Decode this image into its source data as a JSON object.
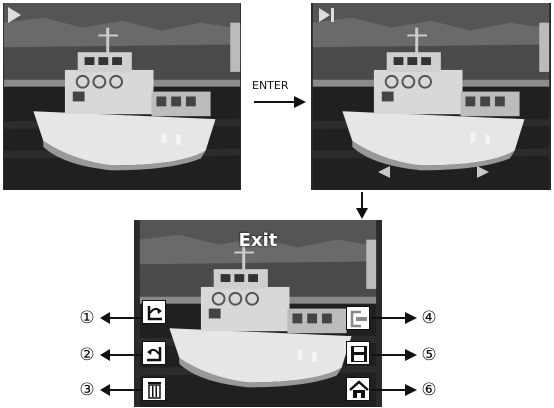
{
  "flow": {
    "enter_label": "ENTER"
  },
  "menu": {
    "exit_label": "Exit",
    "callouts": [
      "①",
      "②",
      "③",
      "④",
      "⑤",
      "⑥"
    ]
  },
  "icons": {
    "screen_a": "play-icon",
    "screen_b": "play-pause-icon",
    "nav": [
      "arrow-left-icon",
      "arrow-right-icon"
    ],
    "menu_buttons": [
      "rotate-right-icon",
      "rotate-left-icon",
      "delete-icon",
      "exit-icon",
      "save-icon",
      "home-icon"
    ]
  },
  "colors": {
    "overlay_icon": "#dcdcdc",
    "background": "#ffffff",
    "text": "#111111"
  }
}
